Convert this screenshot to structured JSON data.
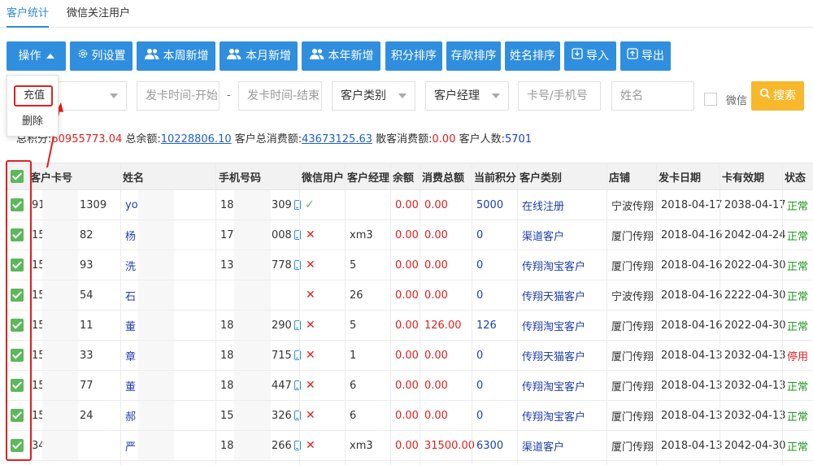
{
  "tabs": [
    {
      "label": "客户统计",
      "active": true
    },
    {
      "label": "微信关注用户",
      "active": false
    }
  ],
  "toolbar": {
    "operate": "操作",
    "columns": "列设置",
    "week_new": "本周新增",
    "month_new": "本月新增",
    "year_new": "本年新增",
    "points_sort": "积分排序",
    "deposit_sort": "存款排序",
    "name_sort": "姓名排序",
    "import": "导入",
    "export": "导出"
  },
  "menu": {
    "recharge": "充值",
    "delete": "删除"
  },
  "filters": {
    "card_start": "发卡时间-开始",
    "dash": "-",
    "card_end": "发卡时间-结束",
    "customer_type": "客户类别",
    "manager": "客户经理",
    "card_phone": "卡号/手机号",
    "name": "姓名",
    "wechat": "微信",
    "search": "搜索"
  },
  "summary": {
    "points_label": "总积分:",
    "points": "60955773.04",
    "balance_label": "总余额:",
    "balance": "10228806.10",
    "spend_label": "客户总消费额:",
    "spend": "43673125.63",
    "walkin_label": "散客消费额:",
    "walkin": "0.00",
    "count_label": "客户人数:",
    "count": "5701"
  },
  "table": {
    "headers": [
      "客户卡号",
      "姓名",
      "手机号码",
      "微信用户",
      "客户经理",
      "余额",
      "消费总额",
      "当前积分",
      "客户类别",
      "店铺",
      "发卡日期",
      "卡有效期",
      "状态"
    ],
    "rows": [
      {
        "card_a": "91",
        "card_b": "1309",
        "name": "yo",
        "phone_a": "18",
        "phone_b": "309",
        "wechat": "yes",
        "manager": "",
        "balance": "0.00",
        "spend": "0.00",
        "points": "5000",
        "type": "在线注册",
        "shop": "宁波传翔",
        "issue": "2018-04-17",
        "expire": "2038-04-17",
        "status": "正常"
      },
      {
        "card_a": "15",
        "card_b": "82",
        "name": "杨",
        "phone_a": "17",
        "phone_b": "008",
        "wechat": "no",
        "manager": "xm3",
        "balance": "0.00",
        "spend": "0.00",
        "points": "0",
        "type": "渠道客户",
        "shop": "厦门传翔",
        "issue": "2018-04-16",
        "expire": "2042-04-24",
        "status": "正常"
      },
      {
        "card_a": "15",
        "card_b": "93",
        "name": "洗",
        "phone_a": "13",
        "phone_b": "778",
        "wechat": "no",
        "manager": "5",
        "balance": "0.00",
        "spend": "0.00",
        "points": "0",
        "type": "传翔淘宝客户",
        "shop": "厦门传翔",
        "issue": "2018-04-16",
        "expire": "2022-04-30",
        "status": "正常"
      },
      {
        "card_a": "15",
        "card_b": "54",
        "name": "石",
        "phone_a": "",
        "phone_b": "",
        "wechat": "no",
        "manager": "26",
        "balance": "0.00",
        "spend": "0.00",
        "points": "0",
        "type": "传翔天猫客户",
        "shop": "宁波传翔",
        "issue": "2018-04-16",
        "expire": "2222-04-30",
        "status": "正常"
      },
      {
        "card_a": "15",
        "card_b": "11",
        "name": "董",
        "phone_a": "18",
        "phone_b": "290",
        "wechat": "no",
        "manager": "5",
        "balance": "0.00",
        "spend": "126.00",
        "points": "126",
        "type": "传翔淘宝客户",
        "shop": "厦门传翔",
        "issue": "2018-04-16",
        "expire": "2022-04-30",
        "status": "正常"
      },
      {
        "card_a": "15",
        "card_b": "33",
        "name": "章",
        "phone_a": "18",
        "phone_b": "715",
        "wechat": "no",
        "manager": "1",
        "balance": "0.00",
        "spend": "0.00",
        "points": "0",
        "type": "传翔天猫客户",
        "shop": "厦门传翔",
        "issue": "2018-04-13",
        "expire": "2032-04-13",
        "status": "停用"
      },
      {
        "card_a": "15",
        "card_b": "77",
        "name": "董",
        "phone_a": "18",
        "phone_b": "447",
        "wechat": "no",
        "manager": "6",
        "balance": "0.00",
        "spend": "0.00",
        "points": "0",
        "type": "传翔淘宝客户",
        "shop": "厦门传翔",
        "issue": "2018-04-13",
        "expire": "2032-04-13",
        "status": "正常"
      },
      {
        "card_a": "15",
        "card_b": "24",
        "name": "郝",
        "phone_a": "15",
        "phone_b": "326",
        "wechat": "no",
        "manager": "6",
        "balance": "0.00",
        "spend": "0.00",
        "points": "0",
        "type": "传翔淘宝客户",
        "shop": "厦门传翔",
        "issue": "2018-04-13",
        "expire": "2032-04-13",
        "status": "正常"
      },
      {
        "card_a": "34",
        "card_b": "",
        "name": "严",
        "phone_a": "18",
        "phone_b": "266",
        "wechat": "no",
        "manager": "xm3",
        "balance": "0.00",
        "spend": "31500.00",
        "points": "6300",
        "type": "渠道客户",
        "shop": "厦门传翔",
        "issue": "2018-04-13",
        "expire": "2042-04-30",
        "status": "正常"
      }
    ]
  },
  "colors": {
    "primary": "#2f8fde",
    "search": "#f7b82c",
    "annotation": "#e02020",
    "ok": "#1a9a1a",
    "red": "#e02020",
    "link": "#1f3fb0"
  }
}
